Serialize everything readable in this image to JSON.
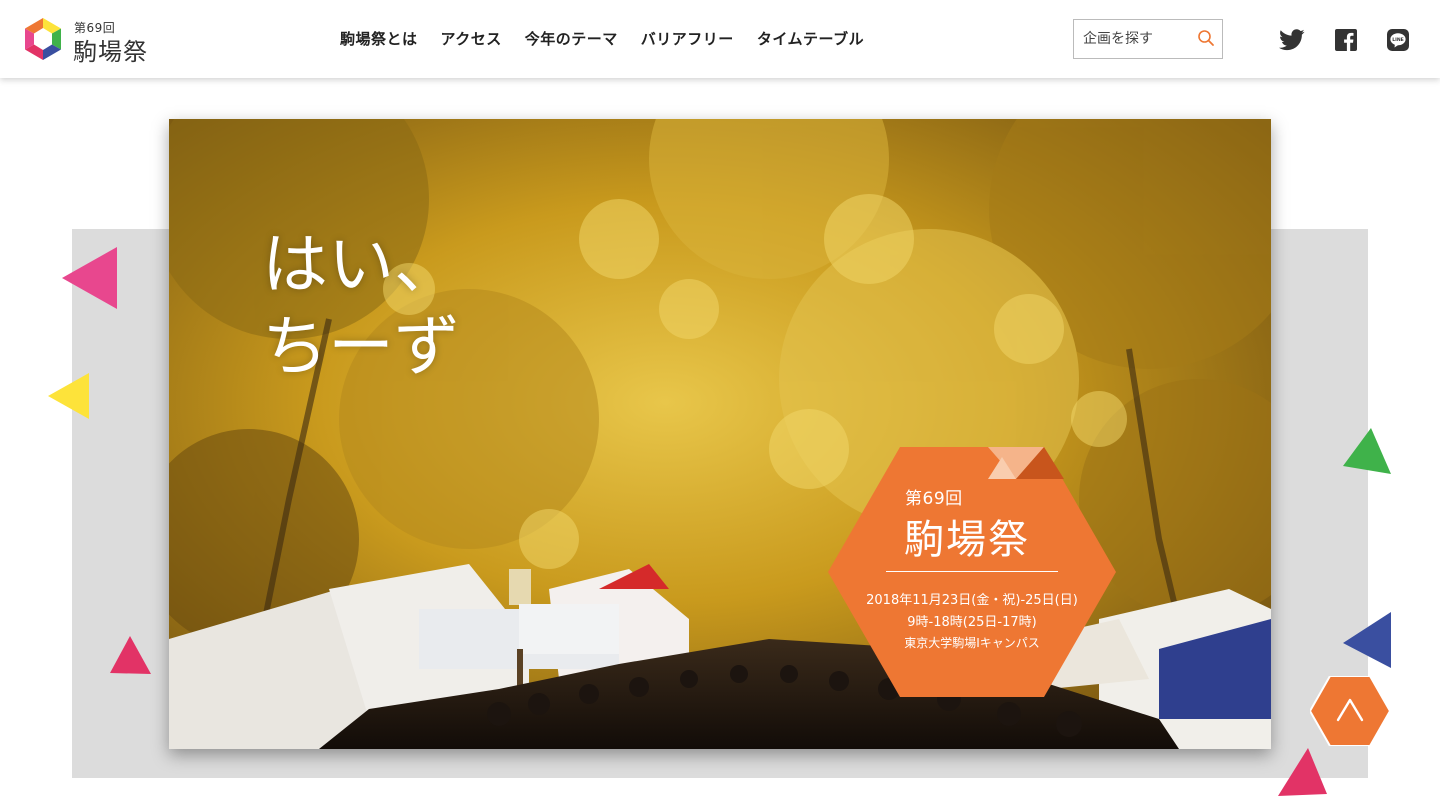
{
  "header": {
    "logo": {
      "edition": "第69回",
      "name": "駒場祭"
    },
    "nav": [
      "駒場祭とは",
      "アクセス",
      "今年のテーマ",
      "バリアフリー",
      "タイムテーブル"
    ],
    "search": {
      "placeholder": "企画を探す",
      "icon": "search-icon"
    },
    "social": [
      "twitter-icon",
      "facebook-icon",
      "line-icon"
    ]
  },
  "hero": {
    "tagline": [
      "はい、",
      "ちーず"
    ],
    "badge": {
      "edition": "第69回",
      "name": "駒場祭",
      "dates": "2018年11月23日(金・祝)-25日(日)",
      "hours": "9時-18時(25日-17時)",
      "venue": "東京大学駒場Ⅰキャンパス"
    },
    "scroll_top_icon": "chevron-up-icon"
  },
  "colors": {
    "accent_orange": "#ee7733",
    "pink": "#e8478e",
    "yellow": "#fde33a",
    "green": "#3fb24a",
    "blue": "#3a4fa0",
    "crimson": "#e23366",
    "panel_gray": "#dcdcdc"
  }
}
